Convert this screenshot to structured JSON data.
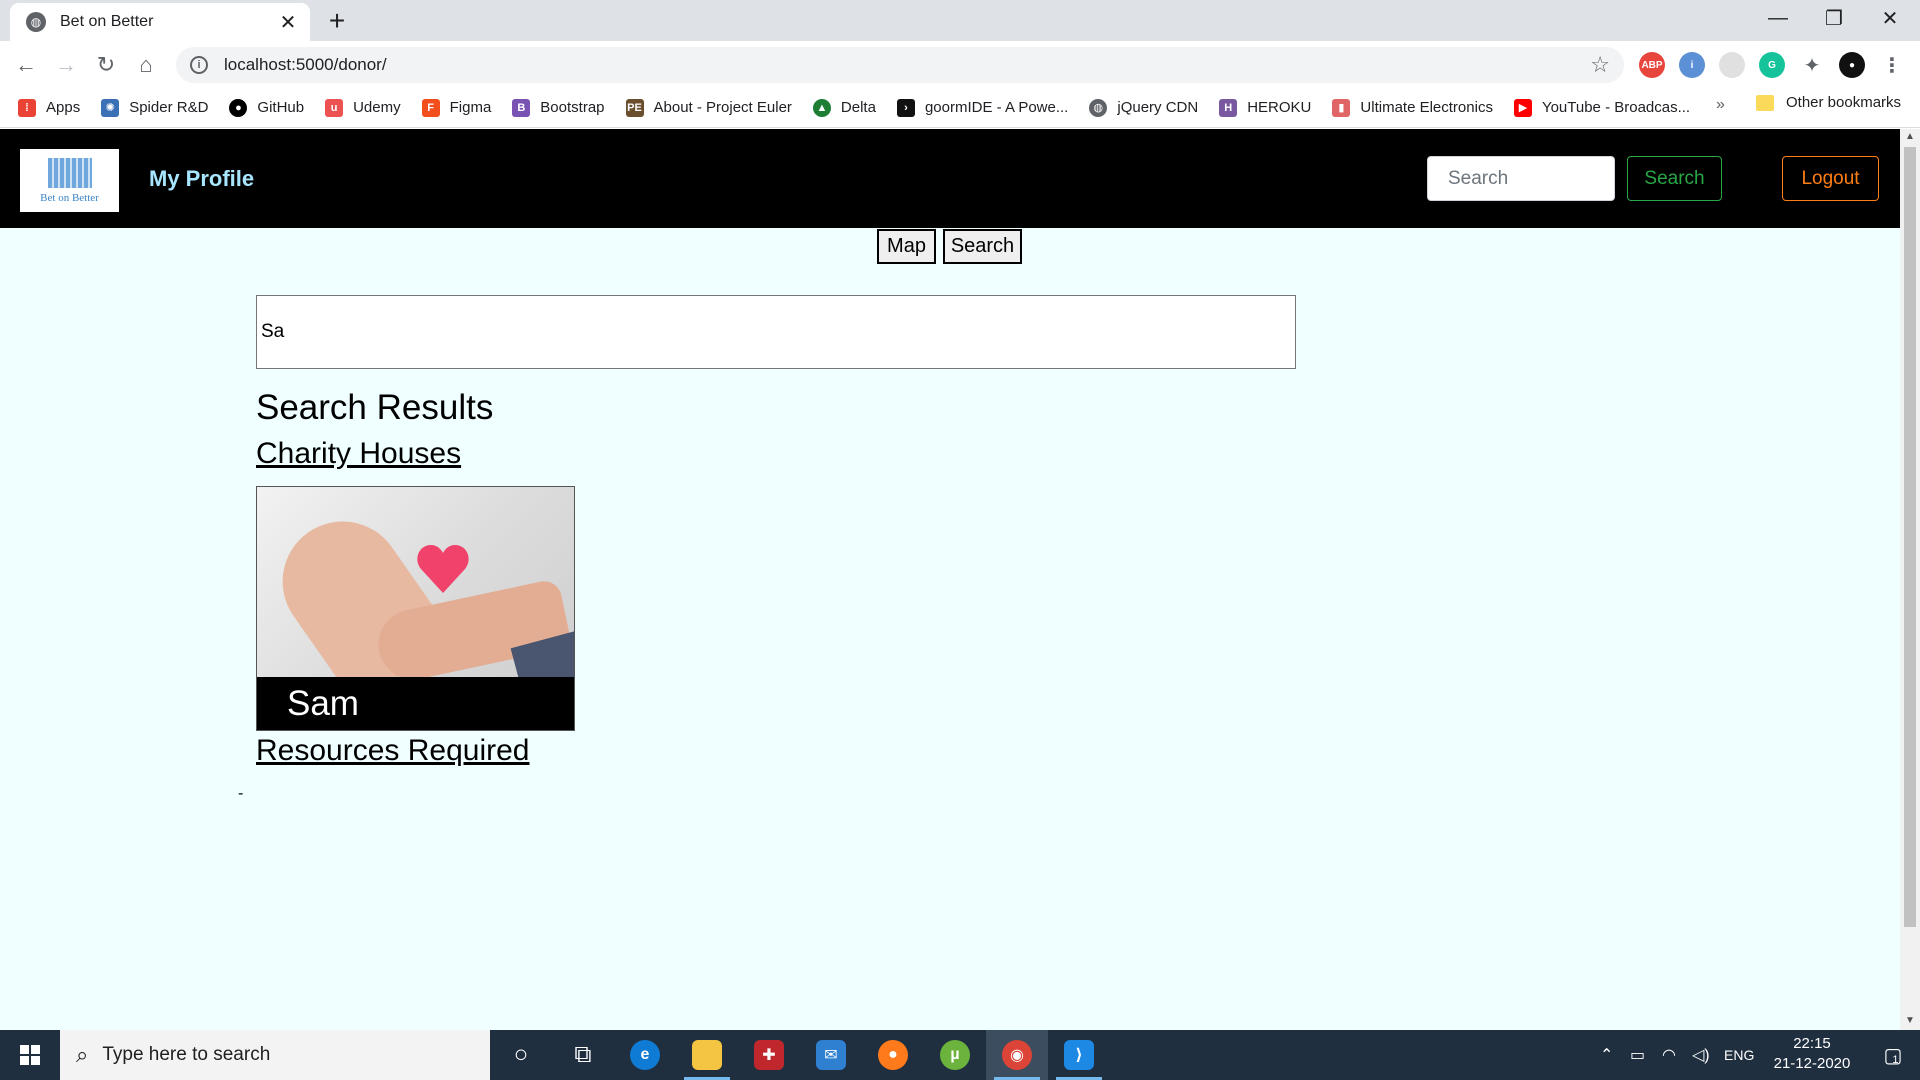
{
  "browser": {
    "tab_title": "Bet on Better",
    "tab_close": "✕",
    "new_tab": "+",
    "url": "localhost:5000/donor/",
    "window_controls": {
      "minimize": "—",
      "restore": "❐",
      "close": "✕"
    },
    "bookmarks": [
      {
        "label": "Apps",
        "icon": "apps-grid-icon",
        "color": "#ea4335"
      },
      {
        "label": "Spider R&D",
        "icon": "spider-icon",
        "color": "#3b6fb6"
      },
      {
        "label": "GitHub",
        "icon": "github-icon",
        "color": "#000000"
      },
      {
        "label": "Udemy",
        "icon": "udemy-icon",
        "color": "#ec5252"
      },
      {
        "label": "Figma",
        "icon": "figma-icon",
        "color": "#f24e1e"
      },
      {
        "label": "Bootstrap",
        "icon": "bootstrap-icon",
        "color": "#7952b3"
      },
      {
        "label": "About - Project Euler",
        "icon": "euler-icon",
        "color": "#6b4e2e"
      },
      {
        "label": "Delta",
        "icon": "delta-icon",
        "color": "#1e7e34"
      },
      {
        "label": "goormIDE - A Powe...",
        "icon": "terminal-icon",
        "color": "#111111"
      },
      {
        "label": "jQuery CDN",
        "icon": "globe-icon",
        "color": "#5f6368"
      },
      {
        "label": "HEROKU",
        "icon": "heroku-icon",
        "color": "#79589f"
      },
      {
        "label": "Ultimate Electronics",
        "icon": "book-icon",
        "color": "#e06666"
      },
      {
        "label": "YouTube - Broadcas...",
        "icon": "youtube-icon",
        "color": "#ff0000"
      }
    ],
    "bookmarks_more": "»",
    "other_bookmarks": "Other bookmarks"
  },
  "site": {
    "logo_text": "Bet on Better",
    "profile_link": "My Profile",
    "nav_search_placeholder": "Search",
    "nav_search_button": "Search",
    "logout_button": "Logout",
    "map_toggle": "Map",
    "search_toggle": "Search",
    "search_value": "Sa",
    "results_heading": "Search Results",
    "charity_section": "Charity Houses",
    "charity_cards": [
      {
        "name": "Sam"
      }
    ],
    "resources_section": "Resources Required",
    "resources_empty": "-"
  },
  "taskbar": {
    "search_placeholder": "Type here to search",
    "language": "ENG",
    "time": "22:15",
    "date": "21-12-2020",
    "notification_count": "1"
  },
  "colors": {
    "page_bg": "#f0ffff",
    "nav_bg": "#000000",
    "search_btn": "#28a745",
    "logout_btn": "#fd7e14",
    "profile_link": "#a8e6ff"
  }
}
